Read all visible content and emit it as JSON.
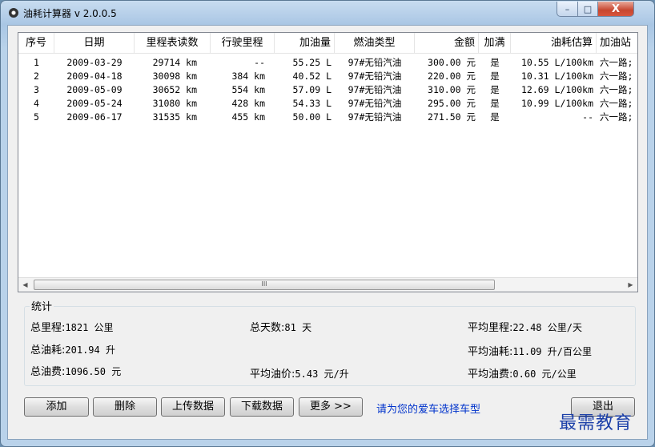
{
  "window": {
    "title": "油耗计算器 v 2.0.0.5",
    "minimize_glyph": "–",
    "maximize_glyph": "□",
    "close_glyph": "X"
  },
  "table": {
    "headers": [
      "序号",
      "日期",
      "里程表读数",
      "行驶里程",
      "加油量",
      "燃油类型",
      "金额",
      "加满",
      "油耗估算",
      "加油站"
    ],
    "rows": [
      [
        "1",
        "2009-03-29",
        "29714 km",
        "--",
        "55.25 L",
        "97#无铅汽油",
        "300.00 元",
        "是",
        "10.55 L/100km",
        "六一路;"
      ],
      [
        "2",
        "2009-04-18",
        "30098 km",
        "384 km",
        "40.52 L",
        "97#无铅汽油",
        "220.00 元",
        "是",
        "10.31 L/100km",
        "六一路;"
      ],
      [
        "3",
        "2009-05-09",
        "30652 km",
        "554 km",
        "57.09 L",
        "97#无铅汽油",
        "310.00 元",
        "是",
        "12.69 L/100km",
        "六一路;"
      ],
      [
        "4",
        "2009-05-24",
        "31080 km",
        "428 km",
        "54.33 L",
        "97#无铅汽油",
        "295.00 元",
        "是",
        "10.99 L/100km",
        "六一路;"
      ],
      [
        "5",
        "2009-06-17",
        "31535 km",
        "455 km",
        "50.00 L",
        "97#无铅汽油",
        "271.50 元",
        "是",
        "--",
        "六一路;"
      ]
    ],
    "scroll_left": "◀",
    "scroll_right": "▶",
    "scroll_grip": "III"
  },
  "stats": {
    "title": "统计",
    "total_distance_label": "总里程:",
    "total_distance_value": "1821 公里",
    "total_days_label": "总天数:",
    "total_days_value": "81 天",
    "avg_distance_label": "平均里程:",
    "avg_distance_value": "22.48 公里/天",
    "total_fuel_label": "总油耗:",
    "total_fuel_value": "201.94 升",
    "avg_fuel_label": "平均油耗:",
    "avg_fuel_value": "11.09 升/百公里",
    "total_cost_label": "总油费:",
    "total_cost_value": "1096.50 元",
    "avg_price_label": "平均油价:",
    "avg_price_value": "5.43 元/升",
    "avg_cost_label": "平均油费:",
    "avg_cost_value": "0.60 元/公里"
  },
  "buttons": {
    "add": "添加",
    "delete": "删除",
    "upload": "上传数据",
    "download": "下载数据",
    "more": "更多 >>",
    "exit": "退出"
  },
  "link_text": "请为您的爱车选择车型",
  "watermark": "最需教育"
}
